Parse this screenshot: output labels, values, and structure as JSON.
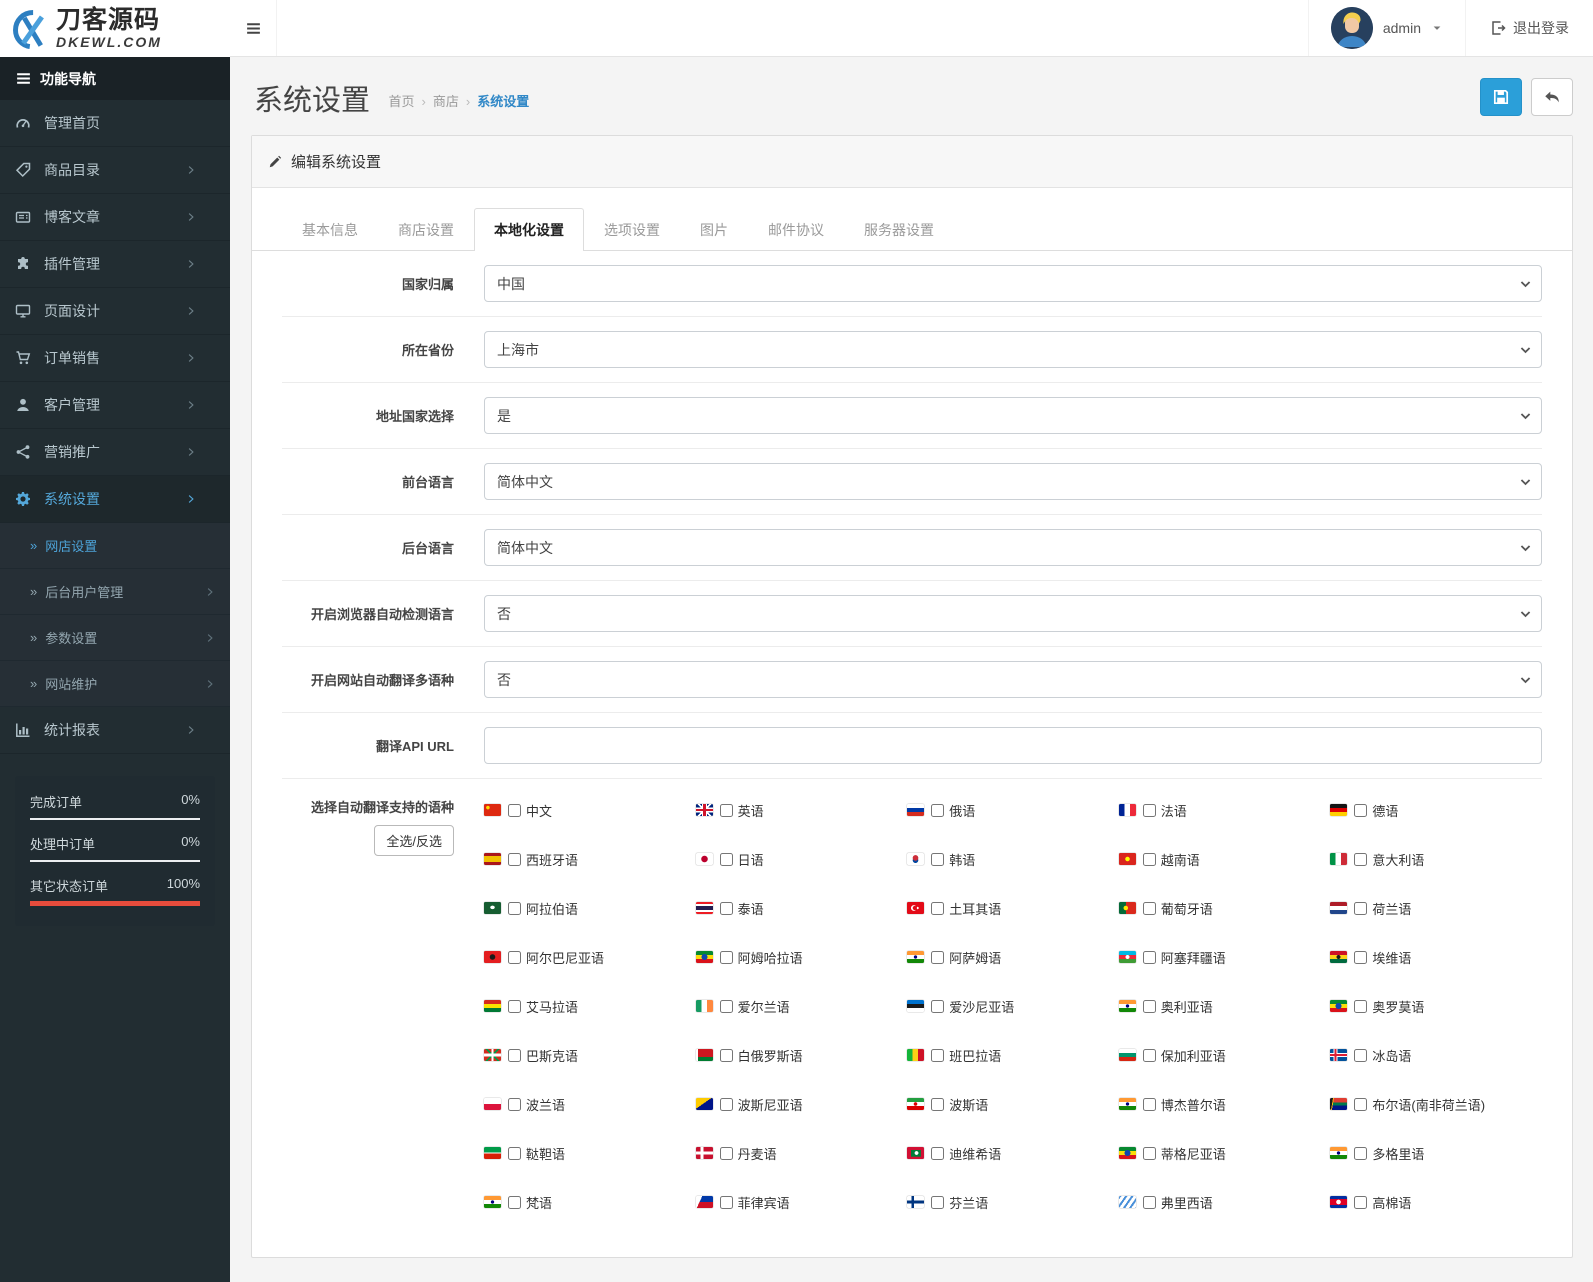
{
  "brand": {
    "name": "刀客源码",
    "domain": "DKEWL.COM"
  },
  "topbar": {
    "user": "admin",
    "logout": "退出登录"
  },
  "colors": {
    "accent": "#2b9fd9",
    "sidebar_active": "#54a7d9",
    "danger": "#e74c3c",
    "breadcrumb_active": "#3188c7"
  },
  "sidebar": {
    "header": "功能导航",
    "items": [
      {
        "label": "管理首页",
        "icon": "dashboard",
        "chevron": false,
        "active": false
      },
      {
        "label": "商品目录",
        "icon": "tags",
        "chevron": true,
        "active": false
      },
      {
        "label": "博客文章",
        "icon": "newspaper",
        "chevron": true,
        "active": false
      },
      {
        "label": "插件管理",
        "icon": "puzzle",
        "chevron": true,
        "active": false
      },
      {
        "label": "页面设计",
        "icon": "desktop",
        "chevron": true,
        "active": false
      },
      {
        "label": "订单销售",
        "icon": "cart",
        "chevron": true,
        "active": false
      },
      {
        "label": "客户管理",
        "icon": "user",
        "chevron": true,
        "active": false
      },
      {
        "label": "营销推广",
        "icon": "share",
        "chevron": true,
        "active": false
      },
      {
        "label": "系统设置",
        "icon": "gear",
        "chevron": true,
        "active": true,
        "submenu": [
          {
            "label": "网店设置",
            "chevron": false,
            "active": true
          },
          {
            "label": "后台用户管理",
            "chevron": true,
            "active": false
          },
          {
            "label": "参数设置",
            "chevron": true,
            "active": false
          },
          {
            "label": "网站维护",
            "chevron": true,
            "active": false
          }
        ]
      },
      {
        "label": "统计报表",
        "icon": "chart",
        "chevron": true,
        "active": false
      }
    ],
    "stats": [
      {
        "label": "完成订单",
        "value": "0%",
        "pct": 0
      },
      {
        "label": "处理中订单",
        "value": "0%",
        "pct": 0
      },
      {
        "label": "其它状态订单",
        "value": "100%",
        "pct": 100
      }
    ]
  },
  "page": {
    "title": "系统设置",
    "breadcrumb": [
      "首页",
      "商店",
      "系统设置"
    ]
  },
  "panel": {
    "title": "编辑系统设置",
    "tabs": [
      {
        "label": "基本信息",
        "active": false
      },
      {
        "label": "商店设置",
        "active": false
      },
      {
        "label": "本地化设置",
        "active": true
      },
      {
        "label": "选项设置",
        "active": false
      },
      {
        "label": "图片",
        "active": false
      },
      {
        "label": "邮件协议",
        "active": false
      },
      {
        "label": "服务器设置",
        "active": false
      }
    ],
    "fields": [
      {
        "id": "country-select",
        "label": "国家归属",
        "type": "select",
        "value": "中国"
      },
      {
        "id": "zone-select",
        "label": "所在省份",
        "type": "select",
        "value": "上海市"
      },
      {
        "id": "address-country-select",
        "label": "地址国家选择",
        "type": "select",
        "value": "是"
      },
      {
        "id": "frontend-language-select",
        "label": "前台语言",
        "type": "select",
        "value": "简体中文"
      },
      {
        "id": "admin-language-select",
        "label": "后台语言",
        "type": "select",
        "value": "简体中文"
      },
      {
        "id": "browser-language-detect-select",
        "label": "开启浏览器自动检测语言",
        "type": "select",
        "value": "否"
      },
      {
        "id": "auto-translate-select",
        "label": "开启网站自动翻译多语种",
        "type": "select",
        "value": "否"
      },
      {
        "id": "translate-api-url-input",
        "label": "翻译API URL",
        "type": "text",
        "value": ""
      }
    ],
    "languages_field": {
      "label": "选择自动翻译支持的语种",
      "toggle_all": "全选/反选",
      "languages": [
        {
          "label": "中文",
          "flag": "cn",
          "checked": false
        },
        {
          "label": "英语",
          "flag": "gb",
          "checked": false
        },
        {
          "label": "俄语",
          "flag": "ru",
          "checked": false
        },
        {
          "label": "法语",
          "flag": "fr",
          "checked": false
        },
        {
          "label": "德语",
          "flag": "de",
          "checked": false
        },
        {
          "label": "西班牙语",
          "flag": "es",
          "checked": false
        },
        {
          "label": "日语",
          "flag": "jp",
          "checked": false
        },
        {
          "label": "韩语",
          "flag": "kr",
          "checked": false
        },
        {
          "label": "越南语",
          "flag": "vn",
          "checked": false
        },
        {
          "label": "意大利语",
          "flag": "it",
          "checked": false
        },
        {
          "label": "阿拉伯语",
          "flag": "sa",
          "checked": false
        },
        {
          "label": "泰语",
          "flag": "th",
          "checked": false
        },
        {
          "label": "土耳其语",
          "flag": "tr",
          "checked": false
        },
        {
          "label": "葡萄牙语",
          "flag": "pt",
          "checked": false
        },
        {
          "label": "荷兰语",
          "flag": "nl",
          "checked": false
        },
        {
          "label": "阿尔巴尼亚语",
          "flag": "al",
          "checked": false
        },
        {
          "label": "阿姆哈拉语",
          "flag": "et",
          "checked": false
        },
        {
          "label": "阿萨姆语",
          "flag": "in",
          "checked": false
        },
        {
          "label": "阿塞拜疆语",
          "flag": "az",
          "checked": false
        },
        {
          "label": "埃维语",
          "flag": "gh",
          "checked": false
        },
        {
          "label": "艾马拉语",
          "flag": "bo",
          "checked": false
        },
        {
          "label": "爱尔兰语",
          "flag": "ie",
          "checked": false
        },
        {
          "label": "爱沙尼亚语",
          "flag": "ee",
          "checked": false
        },
        {
          "label": "奥利亚语",
          "flag": "in",
          "checked": false
        },
        {
          "label": "奥罗莫语",
          "flag": "et",
          "checked": false
        },
        {
          "label": "巴斯克语",
          "flag": "eus",
          "checked": false
        },
        {
          "label": "白俄罗斯语",
          "flag": "by",
          "checked": false
        },
        {
          "label": "班巴拉语",
          "flag": "ml",
          "checked": false
        },
        {
          "label": "保加利亚语",
          "flag": "bg",
          "checked": false
        },
        {
          "label": "冰岛语",
          "flag": "is",
          "checked": false
        },
        {
          "label": "波兰语",
          "flag": "pl",
          "checked": false
        },
        {
          "label": "波斯尼亚语",
          "flag": "ba",
          "checked": false
        },
        {
          "label": "波斯语",
          "flag": "ir",
          "checked": false
        },
        {
          "label": "博杰普尔语",
          "flag": "in",
          "checked": false
        },
        {
          "label": "布尔语(南非荷兰语)",
          "flag": "za",
          "checked": false
        },
        {
          "label": "鞑靼语",
          "flag": "tt",
          "checked": false
        },
        {
          "label": "丹麦语",
          "flag": "dk",
          "checked": false
        },
        {
          "label": "迪维希语",
          "flag": "mv",
          "checked": false
        },
        {
          "label": "蒂格尼亚语",
          "flag": "et",
          "checked": false
        },
        {
          "label": "多格里语",
          "flag": "in",
          "checked": false
        },
        {
          "label": "梵语",
          "flag": "in",
          "checked": false
        },
        {
          "label": "菲律宾语",
          "flag": "ph",
          "checked": false
        },
        {
          "label": "芬兰语",
          "flag": "fi",
          "checked": false
        },
        {
          "label": "弗里西语",
          "flag": "fy",
          "checked": false
        },
        {
          "label": "高棉语",
          "flag": "kh",
          "checked": false
        }
      ]
    }
  }
}
